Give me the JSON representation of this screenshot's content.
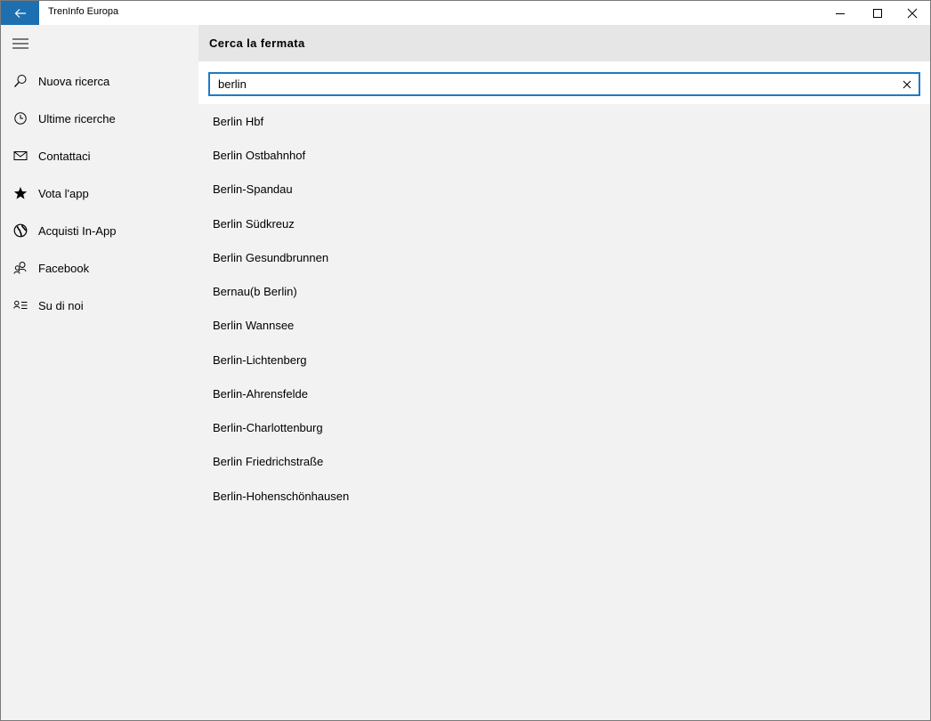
{
  "window": {
    "title": "TrenInfo Europa",
    "accent_color": "#1e6fb0"
  },
  "sidebar": {
    "items": [
      {
        "label": "Nuova ricerca",
        "icon": "search-icon"
      },
      {
        "label": "Ultime ricerche",
        "icon": "clock-icon"
      },
      {
        "label": "Contattaci",
        "icon": "mail-icon"
      },
      {
        "label": "Vota l'app",
        "icon": "star-icon"
      },
      {
        "label": "Acquisti In-App",
        "icon": "globe-icon"
      },
      {
        "label": "Facebook",
        "icon": "people-icon"
      },
      {
        "label": "Su di noi",
        "icon": "contact-card-icon"
      }
    ]
  },
  "main": {
    "title": "Cerca la fermata",
    "search": {
      "value": "berlin",
      "placeholder": ""
    },
    "results": [
      "Berlin Hbf",
      "Berlin Ostbahnhof",
      "Berlin-Spandau",
      "Berlin Südkreuz",
      "Berlin Gesundbrunnen",
      "Bernau(b Berlin)",
      "Berlin Wannsee",
      "Berlin-Lichtenberg",
      "Berlin-Ahrensfelde",
      "Berlin-Charlottenburg",
      "Berlin Friedrichstraße",
      "Berlin-Hohenschönhausen"
    ]
  }
}
